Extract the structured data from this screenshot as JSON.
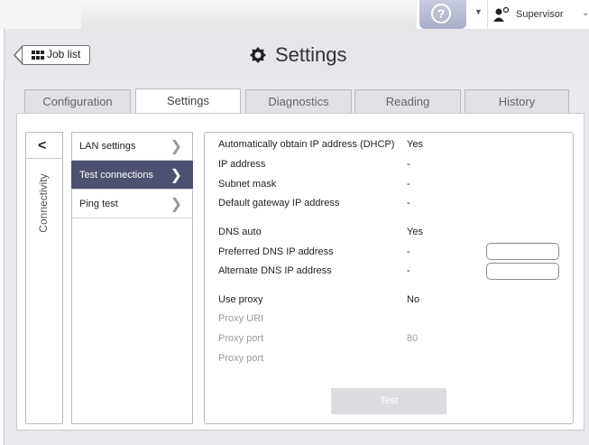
{
  "topbar": {
    "help_symbol": "?",
    "user_label": "Supervisor"
  },
  "header": {
    "back_label": "Job list",
    "title": "Settings"
  },
  "tabs": [
    {
      "label": "Configuration",
      "active": false
    },
    {
      "label": "Settings",
      "active": true
    },
    {
      "label": "Diagnostics",
      "active": false
    },
    {
      "label": "Reading",
      "active": false
    },
    {
      "label": "History",
      "active": false
    }
  ],
  "side": {
    "back_symbol": "<",
    "vertical_label": "Connectivity"
  },
  "menu": [
    {
      "label": "LAN settings",
      "active": false
    },
    {
      "label": "Test connections",
      "active": true
    },
    {
      "label": "Ping test",
      "active": false
    }
  ],
  "settings": {
    "dhcp": {
      "label": "Automatically obtain IP address (DHCP)",
      "value": "Yes"
    },
    "ip": {
      "label": "IP address",
      "value": "-"
    },
    "subnet": {
      "label": "Subnet mask",
      "value": "-"
    },
    "gateway": {
      "label": "Default gateway IP address",
      "value": "-"
    },
    "dns_auto": {
      "label": "DNS auto",
      "value": "Yes"
    },
    "dns_pref": {
      "label": "Preferred DNS IP address",
      "value": "-"
    },
    "dns_alt": {
      "label": "Alternate DNS IP address",
      "value": "-"
    },
    "use_proxy": {
      "label": "Use proxy",
      "value": "No"
    },
    "proxy_uri": {
      "label": "Proxy URI",
      "value": ""
    },
    "proxy_port": {
      "label": "Proxy port",
      "value": "80"
    },
    "proxy_port2": {
      "label": "Proxy port",
      "value": ""
    }
  },
  "actions": {
    "test_label": "Test"
  },
  "colors": {
    "accent": "#4e5072",
    "help_button": "#b0b3cc"
  }
}
